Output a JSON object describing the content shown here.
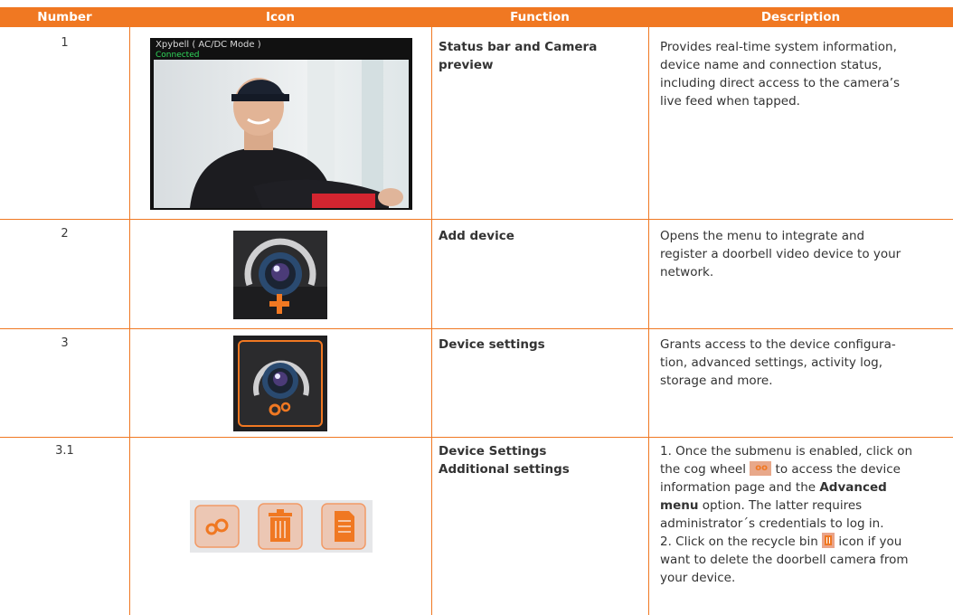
{
  "columns": {
    "number": "Number",
    "icon": "Icon",
    "function": "Function",
    "description": "Description"
  },
  "rows": [
    {
      "number": "1",
      "function_lines": [
        "Status bar and Camera",
        "preview"
      ],
      "description": [
        "Provides real-time system  information,",
        "device name and connection status,",
        "including direct access to the camera’s",
        "live feed when tapped."
      ],
      "preview": {
        "status_title": "Xpybell ( AC/DC Mode )",
        "status_sub": "Connected"
      },
      "icon_name": "camera-preview-thumbnail"
    },
    {
      "number": "2",
      "function_lines": [
        "Add device"
      ],
      "description": [
        "Opens the menu to integrate and",
        "register a doorbell video device to your",
        "network."
      ],
      "icon_name": "add-camera-icon"
    },
    {
      "number": "3",
      "function_lines": [
        "Device settings"
      ],
      "description": [
        "Grants access to the device configura-",
        "tion, advanced settings, activity log,",
        "storage and more."
      ],
      "icon_name": "camera-settings-icon"
    },
    {
      "number": "3.1",
      "function_lines": [
        "Device Settings",
        "Additional settings"
      ],
      "description": {
        "l1": "1. Once the submenu is enabled, click on",
        "l2a": "the cog wheel",
        "l2b": "to access the device",
        "l3": "information page and the",
        "l3b": "Advanced",
        "l4b": "menu",
        "l4": "option. The latter requires",
        "l5": "administrator´s credentials to log in.",
        "l6a": "2. Click on the recycle bin",
        "l6b": "icon if you",
        "l7": "want to  delete the doorbell camera from",
        "l8": "your device."
      },
      "icon_names": [
        "cog-icon",
        "trash-icon",
        "document-icon"
      ]
    }
  ],
  "colors": {
    "accent": "#f07822",
    "text": "#333333"
  }
}
